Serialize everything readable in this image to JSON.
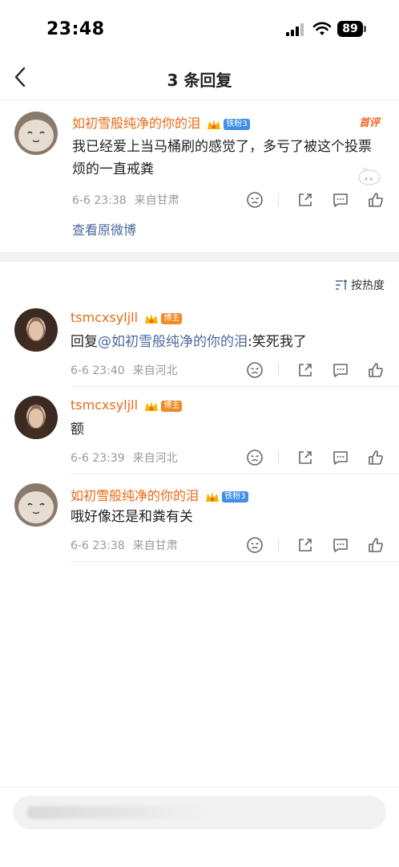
{
  "status_bar": {
    "time": "23:48",
    "battery": "89"
  },
  "nav": {
    "title": "3 条回复"
  },
  "root_comment": {
    "username": "如初雪般纯净的你的泪",
    "fan_badge": "铁粉3",
    "pick_tag": "首评",
    "text": "我已经爱上当马桶刷的感觉了，多亏了被这个投票烦的一直戒粪",
    "date": "6-6 23:38",
    "location": "来自甘肃",
    "view_original": "查看原微博"
  },
  "sort": {
    "label": "按热度"
  },
  "replies": [
    {
      "username": "tsmcxsyljll",
      "badge": "博主",
      "reply_prefix": "回复",
      "mention": "@如初雪般纯净的你的泪",
      "text": ":笑死我了",
      "date": "6-6 23:40",
      "location": "来自河北"
    },
    {
      "username": "tsmcxsyljll",
      "badge": "博主",
      "text": "额",
      "date": "6-6 23:39",
      "location": "来自河北"
    },
    {
      "username": "如初雪般纯净的你的泪",
      "badge": "铁粉3",
      "text": "哦好像还是和粪有关",
      "date": "6-6 23:38",
      "location": "来自甘肃"
    }
  ],
  "colors": {
    "username": "#e86a17",
    "link": "#4a6a9c",
    "meta": "#999999",
    "fan_badge": "#3f8fe6",
    "author_badge": "#f08a24"
  },
  "icons": [
    "back-icon",
    "emoji-icon",
    "share-icon",
    "comment-icon",
    "like-icon",
    "sort-icon",
    "signal-icon",
    "wifi-icon"
  ]
}
